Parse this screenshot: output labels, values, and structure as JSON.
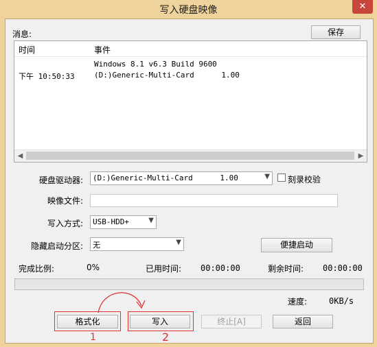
{
  "window": {
    "title": "写入硬盘映像",
    "close_glyph": "✕"
  },
  "log": {
    "label": "消息:",
    "save_button": "保存",
    "columns": {
      "time": "时间",
      "event": "事件"
    },
    "rows": [
      {
        "time": "",
        "event": "Windows 8.1 v6.3 Build 9600"
      },
      {
        "time": "下午 10:50:33",
        "event": "(D:)Generic-Multi-Card      1.00"
      }
    ]
  },
  "form": {
    "drive_label": "硬盘驱动器:",
    "drive_value": "(D:)Generic-Multi-Card      1.00",
    "verify_label": "刻录校验",
    "verify_checked": false,
    "image_file_label": "映像文件:",
    "image_file_value": "",
    "write_mode_label": "写入方式:",
    "write_mode_value": "USB-HDD+",
    "hidden_partition_label": "隐藏启动分区:",
    "hidden_partition_value": "无",
    "quick_boot_button": "便捷启动"
  },
  "status": {
    "completion_label": "完成比例:",
    "completion_value": "0%",
    "completion_fraction": 0,
    "elapsed_label": "已用时间:",
    "elapsed_value": "00:00:00",
    "remaining_label": "剩余时间:",
    "remaining_value": "00:00:00",
    "speed_label": "速度:",
    "speed_value": "0KB/s"
  },
  "buttons": {
    "format": "格式化",
    "write": "写入",
    "abort": "终止[A]",
    "back": "返回"
  },
  "annotations": {
    "mark_1": "1",
    "mark_2": "2",
    "color": "#e03030"
  }
}
